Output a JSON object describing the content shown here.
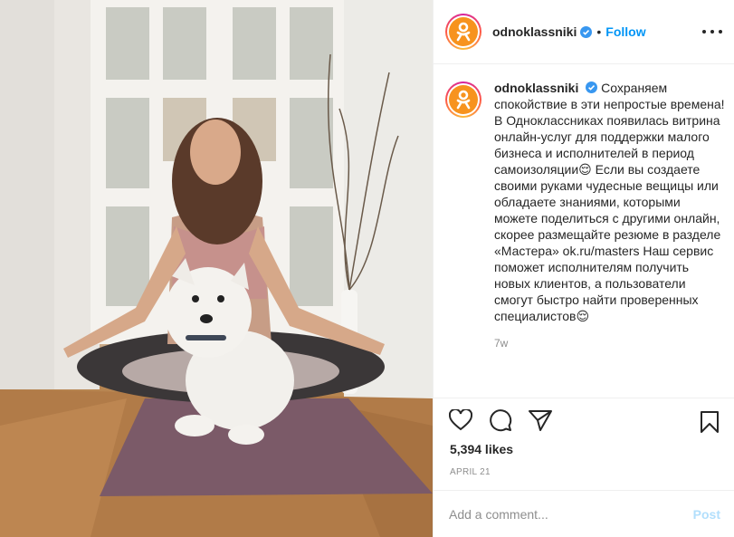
{
  "account": {
    "username": "odnoklassniki",
    "follow_label": "Follow",
    "separator": "•",
    "brand_color": "#f7931e"
  },
  "post": {
    "caption_user": "odnoklassniki",
    "caption_text": "Сохраняем спокойствие в эти непростые времена! В Одноклассниках появилась витрина онлайн-услуг для поддержки малого бизнеса и исполнителей в период самоизоляции😌 Если вы создаете своими руками чудесные вещицы или обладаете знаниями, которыми можете поделиться с другими онлайн, скорее размещайте резюме в разделе «Мастера» ok.ru/masters Наш сервис поможет исполнителям получить новых клиентов, а пользователи смогут быстро найти проверенных специалистов😌",
    "time_ago": "7w",
    "likes": "5,394 likes",
    "date": "APRIL 21"
  },
  "icons": {
    "like": "heart-icon",
    "comment": "comment-icon",
    "share": "share-icon",
    "save": "bookmark-icon",
    "more": "more-options-icon",
    "verified": "verified-badge-icon"
  },
  "comment_box": {
    "placeholder": "Add a comment...",
    "post_label": "Post"
  },
  "colors": {
    "link": "#0095f6",
    "post_disabled": "#b2dffc",
    "muted": "#8e8e8e"
  }
}
